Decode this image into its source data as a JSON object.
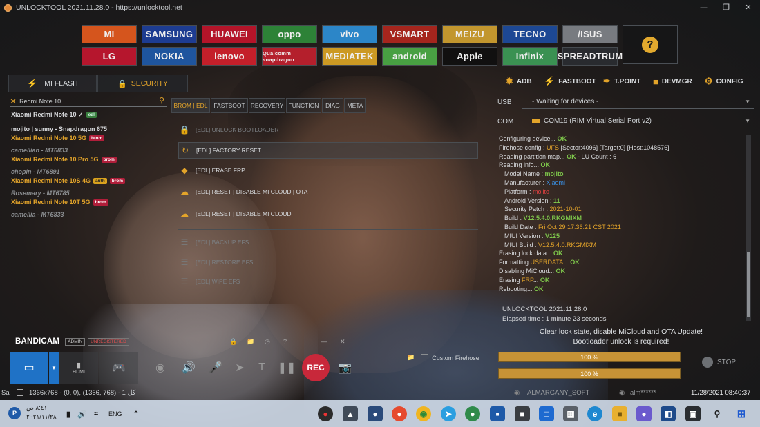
{
  "window": {
    "title": "UNLOCKTOOL 2021.11.28.0 - https://unlocktool.net"
  },
  "brands": [
    {
      "label": "MI",
      "bg": "#e45a1e",
      "fg": "#ffffff"
    },
    {
      "label": "SAMSUNG",
      "bg": "#1e3f9a",
      "fg": "#ffffff"
    },
    {
      "label": "HUAWEI",
      "bg": "#c0142b",
      "fg": "#ffffff"
    },
    {
      "label": "oppo",
      "bg": "#2f8a3a",
      "fg": "#ffffff"
    },
    {
      "label": "vivo",
      "bg": "#2d8fd6",
      "fg": "#ffffff"
    },
    {
      "label": "VSMART",
      "bg": "#b0261e",
      "fg": "#ffffff"
    },
    {
      "label": "MEIZU",
      "bg": "#cfa030",
      "fg": "#ffffff"
    },
    {
      "label": "TECNO",
      "bg": "#1d4c9e",
      "fg": "#ffffff"
    },
    {
      "label": "/ISUS",
      "bg": "#7f8388",
      "fg": "#ffffff"
    },
    {
      "label": "LG",
      "bg": "#c2162f",
      "fg": "#ffffff"
    },
    {
      "label": "NOKIA",
      "bg": "#1f5aa8",
      "fg": "#ffffff"
    },
    {
      "label": "lenovo",
      "bg": "#d1202c",
      "fg": "#ffffff"
    },
    {
      "label": "Qualcomm snapdragon",
      "bg": "#c0202e",
      "fg": "#ffffff"
    },
    {
      "label": "MEDIATEK",
      "bg": "#d9a324",
      "fg": "#ffffff"
    },
    {
      "label": "android",
      "bg": "#4caa46",
      "fg": "#ffffff"
    },
    {
      "label": "Apple",
      "bg": "#101010",
      "fg": "#ffffff"
    },
    {
      "label": "Infinix",
      "bg": "#3d9a57",
      "fg": "#ffffff"
    },
    {
      "label": "SPREADTRUM",
      "bg": "#2a2d31",
      "fg": "#ffffff"
    }
  ],
  "left": {
    "tab_miflash": "MI FLASH",
    "tab_security": "SECURITY",
    "search_value": "Redmi Note 10",
    "devices": [
      {
        "name": "Xiaomi Redmi Note 10 ✓",
        "badges": [
          "edl"
        ],
        "model": "",
        "dim": false
      },
      {
        "name": "mojito | sunny - Snapdragon 675",
        "badges": [],
        "model": "Xiaomi Redmi Note 10 5G",
        "model_badges": [
          "brom"
        ],
        "dim": false
      },
      {
        "name": "camellian - MT6833",
        "badges": [],
        "model": "Xiaomi Redmi Note 10 Pro 5G",
        "model_badges": [
          "brom"
        ],
        "dim": true
      },
      {
        "name": "chopin - MT6891",
        "badges": [],
        "model": "Xiaomi Redmi Note 10S 4G",
        "model_badges": [
          "auth",
          "brom"
        ],
        "dim": true
      },
      {
        "name": "Rosemary - MT6785",
        "badges": [],
        "model": "Xiaomi Redmi Note 10T 5G",
        "model_badges": [
          "brom"
        ],
        "dim": true
      },
      {
        "name": "camellia - MT6833",
        "badges": [],
        "model": "",
        "dim": true
      }
    ]
  },
  "middle": {
    "tabs": [
      "BROM | EDL",
      "FASTBOOT",
      "RECOVERY",
      "FUNCTION",
      "DIAG",
      "META"
    ],
    "functions": [
      {
        "label": "[EDL] UNLOCK BOOTLOADER",
        "icon": "lock-icon",
        "dim": true
      },
      {
        "label": "[EDL] FACTORY RESET",
        "icon": "reset-icon",
        "dim": false
      },
      {
        "label": "[EDL] ERASE FRP",
        "icon": "eraser-icon",
        "dim": false
      },
      {
        "label": "[EDL] RESET | DISABLE MI CLOUD | OTA",
        "icon": "cloud-icon",
        "dim": false
      },
      {
        "label": "[EDL] RESET | DISABLE MI CLOUD",
        "icon": "cloud-icon",
        "dim": false
      },
      {
        "label": "[EDL] BACKUP EFS",
        "icon": "list-icon",
        "dim": true
      },
      {
        "label": "[EDL] RESTORE EFS",
        "icon": "list-icon",
        "dim": true
      },
      {
        "label": "[EDL] WIPE EFS",
        "icon": "list-icon",
        "dim": true
      }
    ],
    "custom_firehose": "Custom Firehose"
  },
  "right": {
    "tools": [
      "ADB",
      "FASTBOOT",
      "T.POINT",
      "DEVMGR",
      "CONFIG"
    ],
    "usb_label": "USB",
    "usb_value": "- Waiting for devices -",
    "com_label": "COM",
    "com_value": "COM19 (RIM Virtual Serial Port v2)",
    "log": [
      [
        {
          "t": "Configuring device... ",
          "c": ""
        },
        {
          "t": "OK",
          "c": "g"
        }
      ],
      [
        {
          "t": "Firehose config : ",
          "c": ""
        },
        {
          "t": "UFS",
          "c": "o"
        },
        {
          "t": " [Sector:4096] [Target:0] [Host:1048576]",
          "c": ""
        }
      ],
      [
        {
          "t": "Reading partition map... ",
          "c": ""
        },
        {
          "t": "OK",
          "c": "g"
        },
        {
          "t": " - LU Count : 6",
          "c": ""
        }
      ],
      [
        {
          "t": "Reading info... ",
          "c": ""
        },
        {
          "t": "OK",
          "c": "g"
        }
      ],
      [
        {
          "t": "Model Name : ",
          "c": "",
          "ind": true
        },
        {
          "t": "mojito",
          "c": "g"
        }
      ],
      [
        {
          "t": "Manufacturer : ",
          "c": "",
          "ind": true
        },
        {
          "t": "Xiaomi",
          "c": "b"
        }
      ],
      [
        {
          "t": "Platform : ",
          "c": "",
          "ind": true
        },
        {
          "t": "mojito",
          "c": "r"
        }
      ],
      [
        {
          "t": "Android Version : ",
          "c": "",
          "ind": true
        },
        {
          "t": "11",
          "c": "g"
        }
      ],
      [
        {
          "t": "Security Patch : ",
          "c": "",
          "ind": true
        },
        {
          "t": "2021-10-01",
          "c": "o"
        }
      ],
      [
        {
          "t": "Build : ",
          "c": "",
          "ind": true
        },
        {
          "t": "V12.5.4.0.RKGMIXM",
          "c": "g"
        }
      ],
      [
        {
          "t": "Build Date : ",
          "c": "",
          "ind": true
        },
        {
          "t": "Fri Oct 29 17:36:21 CST 2021",
          "c": "o"
        }
      ],
      [
        {
          "t": "MIUI Version : ",
          "c": "",
          "ind": true
        },
        {
          "t": "V125",
          "c": "g"
        }
      ],
      [
        {
          "t": "MIUI Build : ",
          "c": "",
          "ind": true
        },
        {
          "t": "V12.5.4.0.RKGMIXM",
          "c": "o"
        }
      ],
      [
        {
          "t": "Erasing lock data... ",
          "c": ""
        },
        {
          "t": "OK",
          "c": "g"
        }
      ],
      [
        {
          "t": "Formatting ",
          "c": ""
        },
        {
          "t": "USERDATA",
          "c": "o"
        },
        {
          "t": "... ",
          "c": ""
        },
        {
          "t": "OK",
          "c": "g"
        }
      ],
      [
        {
          "t": "Disabling MiCloud... ",
          "c": ""
        },
        {
          "t": "OK",
          "c": "g"
        }
      ],
      [
        {
          "t": "Erasing ",
          "c": ""
        },
        {
          "t": "FRP",
          "c": "o"
        },
        {
          "t": "... ",
          "c": ""
        },
        {
          "t": "OK",
          "c": "g"
        }
      ],
      [
        {
          "t": "Rebooting... ",
          "c": ""
        },
        {
          "t": "OK",
          "c": "g"
        }
      ]
    ],
    "version_line": "UNLOCKTOOL 2021.11.28.0",
    "elapsed_line": "Elapsed time : 1 minute 23 seconds",
    "notice1": "Clear lock state, disable MiCloud and OTA Update!",
    "notice2": "Bootloader unlock is required!",
    "progress1": "100 %",
    "progress2": "100 %",
    "stop_label": "STOP"
  },
  "bandicam": {
    "logo": "BANDICAM",
    "admin": "ADMIN",
    "unregistered": "UNREGISTERED",
    "rec": "REC",
    "hdmi": "HDMI"
  },
  "status": {
    "left_text": "Sa",
    "resolution": "1366x768 - (0, 0), (1366, 768) - کل 1",
    "user_a": "ALMARGANY_SOFT",
    "user_b": "alm******",
    "datetime": "11/28/2021 08:40:37"
  },
  "taskbar": {
    "time": "٨:٤١ ص",
    "date": "٢٠٢١/١١/٢٨",
    "lang": "ENG"
  }
}
